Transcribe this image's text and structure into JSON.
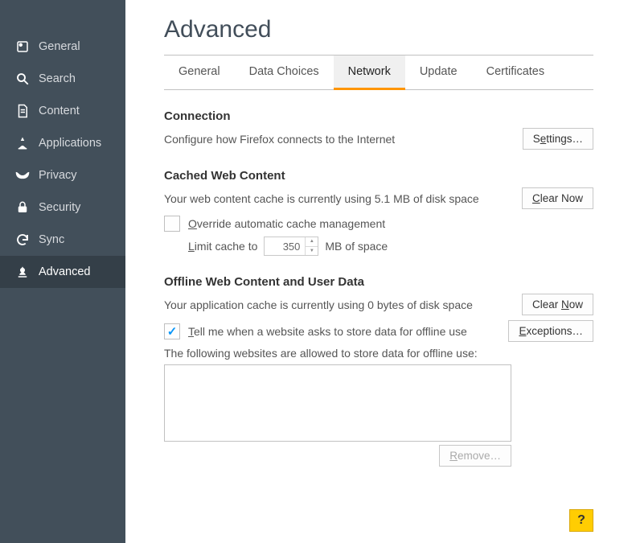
{
  "sidebar": {
    "items": [
      {
        "label": "General"
      },
      {
        "label": "Search"
      },
      {
        "label": "Content"
      },
      {
        "label": "Applications"
      },
      {
        "label": "Privacy"
      },
      {
        "label": "Security"
      },
      {
        "label": "Sync"
      },
      {
        "label": "Advanced"
      }
    ]
  },
  "page_title": "Advanced",
  "tabs": [
    {
      "label": "General"
    },
    {
      "label": "Data Choices"
    },
    {
      "label": "Network"
    },
    {
      "label": "Update"
    },
    {
      "label": "Certificates"
    }
  ],
  "connection": {
    "title": "Connection",
    "desc": "Configure how Firefox connects to the Internet",
    "settings_prefix": "S",
    "settings_accel": "e",
    "settings_suffix": "ttings…"
  },
  "cache": {
    "title": "Cached Web Content",
    "desc": "Your web content cache is currently using 5.1 MB of disk space",
    "clear_accel": "C",
    "clear_rest": "lear Now",
    "override_accel": "O",
    "override_rest": "verride automatic cache management",
    "limit_accel": "L",
    "limit_rest": "imit cache to",
    "limit_value": "350",
    "limit_unit": "MB of space"
  },
  "offline": {
    "title": "Offline Web Content and User Data",
    "desc": "Your application cache is currently using 0 bytes of disk space",
    "clear_prefix": "Clear ",
    "clear_accel": "N",
    "clear_suffix": "ow",
    "tell_accel": "T",
    "tell_rest": "ell me when a website asks to store data for offline use",
    "exceptions_accel": "E",
    "exceptions_rest": "xceptions…",
    "allowed_text": "The following websites are allowed to store data for offline use:",
    "remove_accel": "R",
    "remove_rest": "emove…"
  },
  "help": "?"
}
